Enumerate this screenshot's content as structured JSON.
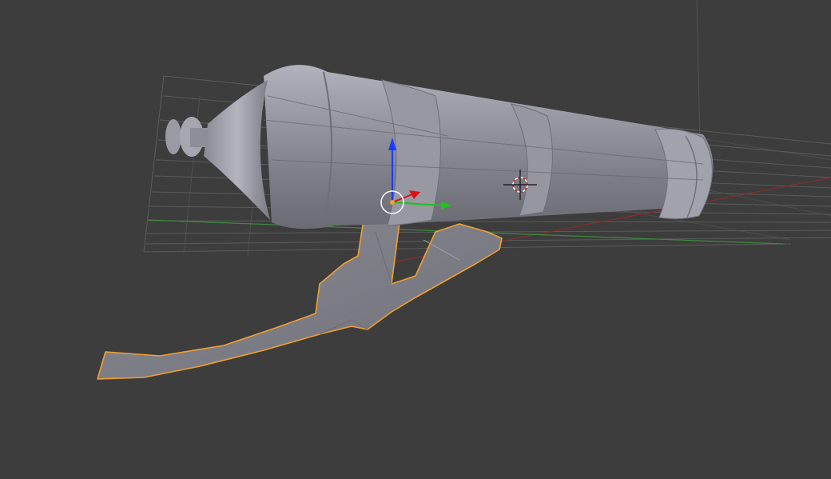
{
  "app": "3D viewport",
  "colors": {
    "background": "#3d3d3d",
    "grid_line": "#5a5a5a",
    "x_axis": "#8a2a2a",
    "y_axis": "#3e8a3e",
    "selection_outline": "#f0a030",
    "gizmo_z": "#1a3cff",
    "gizmo_y": "#1fc21f",
    "gizmo_x": "#e01010",
    "mesh_body": "#8d8d98"
  },
  "viewport": {
    "objects": [
      {
        "name": "cannon-barrel",
        "selected": false
      },
      {
        "name": "cannon-carriage",
        "selected": true
      }
    ],
    "gizmo": {
      "axes": [
        "x",
        "y",
        "z"
      ]
    },
    "cursor": "3d-cursor"
  }
}
